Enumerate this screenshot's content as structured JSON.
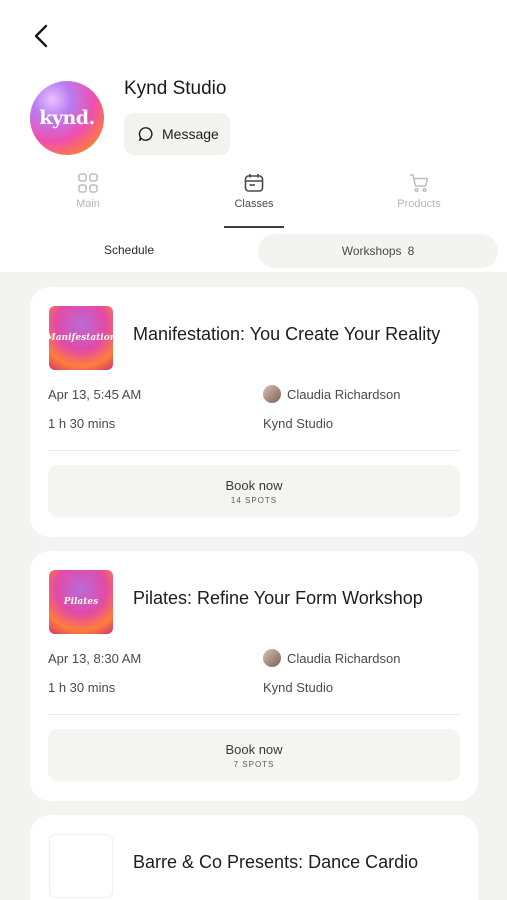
{
  "header": {
    "studio_name": "Kynd Studio",
    "avatar_text": "kynd.",
    "message_label": "Message"
  },
  "tabs": [
    {
      "label": "Main",
      "icon": "grid-icon"
    },
    {
      "label": "Classes",
      "icon": "calendar-icon",
      "active": true
    },
    {
      "label": "Products",
      "icon": "cart-icon"
    }
  ],
  "subtabs": {
    "schedule": "Schedule",
    "workshops": "Workshops",
    "workshops_count": "8"
  },
  "cards": [
    {
      "thumb_text": "Manifestation",
      "title": "Manifestation: You Create Your Reality",
      "datetime": "Apr 13, 5:45 AM",
      "duration": "1 h 30 mins",
      "instructor": "Claudia Richardson",
      "location": "Kynd Studio",
      "book_label": "Book now",
      "spots": "14 SPOTS"
    },
    {
      "thumb_text": "Pilates",
      "title": "Pilates: Refine Your Form Workshop",
      "datetime": "Apr 13, 8:30 AM",
      "duration": "1 h 30 mins",
      "instructor": "Claudia Richardson",
      "location": "Kynd Studio",
      "book_label": "Book now",
      "spots": "7 SPOTS"
    },
    {
      "title": "Barre & Co Presents: Dance Cardio"
    }
  ]
}
